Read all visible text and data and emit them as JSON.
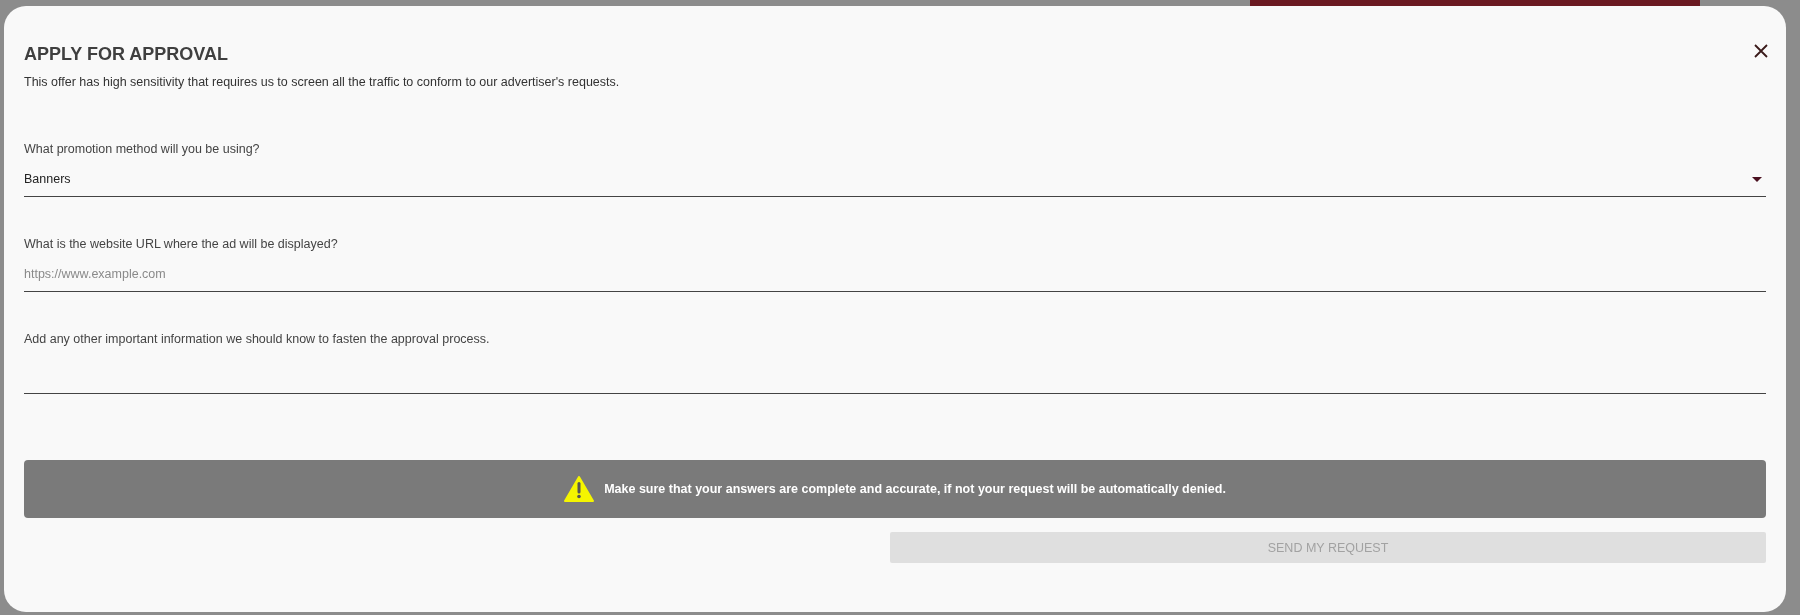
{
  "dialog": {
    "title": "APPLY FOR APPROVAL",
    "description": "This offer has high sensitivity that requires us to screen all the traffic to conform to our advertiser's requests.",
    "fields": [
      {
        "kind": "select",
        "label": "What promotion method will you be using?",
        "value": "Banners"
      },
      {
        "kind": "text",
        "label": "What is the website URL where the ad will be displayed?",
        "placeholder": "https://www.example.com"
      },
      {
        "kind": "textarea",
        "label": "Add any other important information we should know to fasten the approval process."
      }
    ],
    "warning": "Make sure that your answers are complete and accurate, if not your request will be automatically denied.",
    "submit": {
      "label": "SEND MY REQUEST",
      "disabled": true
    }
  }
}
